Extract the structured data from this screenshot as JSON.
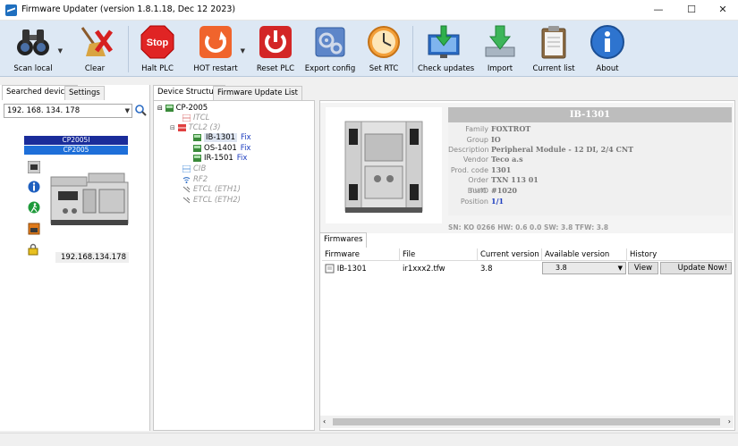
{
  "window": {
    "title": "Firmware Updater (version 1.8.1.18, Dec 12 2023)",
    "controls": {
      "minimize": "—",
      "maximize": "☐",
      "close": "✕"
    }
  },
  "toolbar": {
    "scan_local": "Scan local",
    "clear": "Clear",
    "halt_plc": "Halt PLC",
    "stop_text": "Stop",
    "hot_restart": "HOT restart",
    "reset_plc": "Reset PLC",
    "export_config": "Export config",
    "set_rtc": "Set RTC",
    "check_updates": "Check updates",
    "import": "Import",
    "current_list": "Current list",
    "about": "About"
  },
  "left": {
    "tabs": [
      "Searched devices",
      "Settings"
    ],
    "ip_combo": "192. 168. 134. 178",
    "device_name": "CP2005I",
    "device_type": "CP2005",
    "ip_label": "192.168.134.178"
  },
  "middle": {
    "tabs": [
      "Device Structure",
      "Firmware Update List"
    ],
    "tree": {
      "root": "CP-2005",
      "itcl": "ITCL",
      "tcl2": "TCL2 (3)",
      "mod1": "IB-1301",
      "mod2": "OS-1401",
      "mod3": "IR-1501",
      "fix": "Fix",
      "cib": "CIB",
      "rf2": "RF2",
      "etcl1": "ETCL (ETH1)",
      "etcl2": "ETCL (ETH2)"
    }
  },
  "info": {
    "header": "IB-1301",
    "props": [
      {
        "k": "Family",
        "v": "FOXTROT"
      },
      {
        "k": "Group",
        "v": "IO"
      },
      {
        "k": "Description",
        "v": "Peripheral Module - 12 DI, 2/4 CNT"
      },
      {
        "k": "Vendor",
        "v": "Teco a.s"
      },
      {
        "k": "Prod. code",
        "v": "1301"
      },
      {
        "k": "Order num.",
        "v": "TXN 113 01"
      },
      {
        "k": "BusID",
        "v": "#1020"
      },
      {
        "k": "Position",
        "v": "1/1"
      }
    ],
    "sn_line": "SN: KO 0266 HW: 0.6 0.0 SW: 3.8 TFW: 3.8"
  },
  "firmware": {
    "tab": "Firmwares",
    "columns": [
      "Firmware",
      "File",
      "Current version",
      "Available version",
      "History"
    ],
    "row": {
      "firmware": "IB-1301",
      "file": "ir1xxx2.tfw",
      "current": "3.8",
      "available": "3.8",
      "view": "View",
      "update": "Update Now!"
    }
  },
  "colors": {
    "toolbar_bg": "#dde8f4",
    "device_name_bg": "#1a2c9a",
    "device_type_bg": "#1e6fd9",
    "link_blue": "#2040c0"
  }
}
